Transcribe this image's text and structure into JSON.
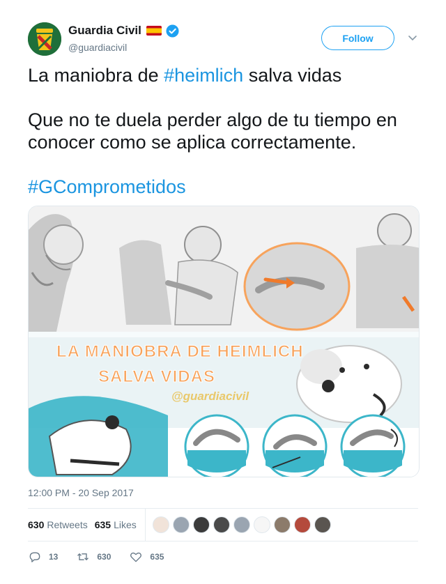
{
  "account": {
    "display_name": "Guardia Civil",
    "handle": "@guardiacivil",
    "verified": true,
    "flag_icon": "spain-flag-icon",
    "avatar_color": "#1f6f3a"
  },
  "follow_label": "Follow",
  "tweet": {
    "line1_before": "La maniobra de ",
    "line1_hashtag": "#heimlich",
    "line1_after": " salva vidas",
    "paragraph2": "Que no te duela perder algo de tu tiempo en conocer como se aplica correctamente.",
    "hashtag2": "#GComprometidos"
  },
  "media": {
    "banner_line1": "LA MANIOBRA DE HEIMLICH",
    "banner_line2": "SALVA VIDAS",
    "watermark": "@guardiacivil"
  },
  "timestamp": "12:00 PM - 20 Sep 2017",
  "stats": {
    "retweets_count": "630",
    "retweets_label": "Retweets",
    "likes_count": "635",
    "likes_label": "Likes"
  },
  "likers": [
    "#f1e3d9",
    "#9aa5b1",
    "#3b3b3b",
    "#4a4a4a",
    "#9aa5b1",
    "#f6f6f6",
    "#8c7b6b",
    "#b44a3c",
    "#5a5550"
  ],
  "actions": {
    "replies": "13",
    "retweets": "630",
    "likes": "635"
  },
  "colors": {
    "link": "#1b95e0",
    "follow": "#1da1f2",
    "muted": "#657786",
    "banner_orange": "#f7a35c",
    "banner_teal": "#3cb6c9"
  }
}
